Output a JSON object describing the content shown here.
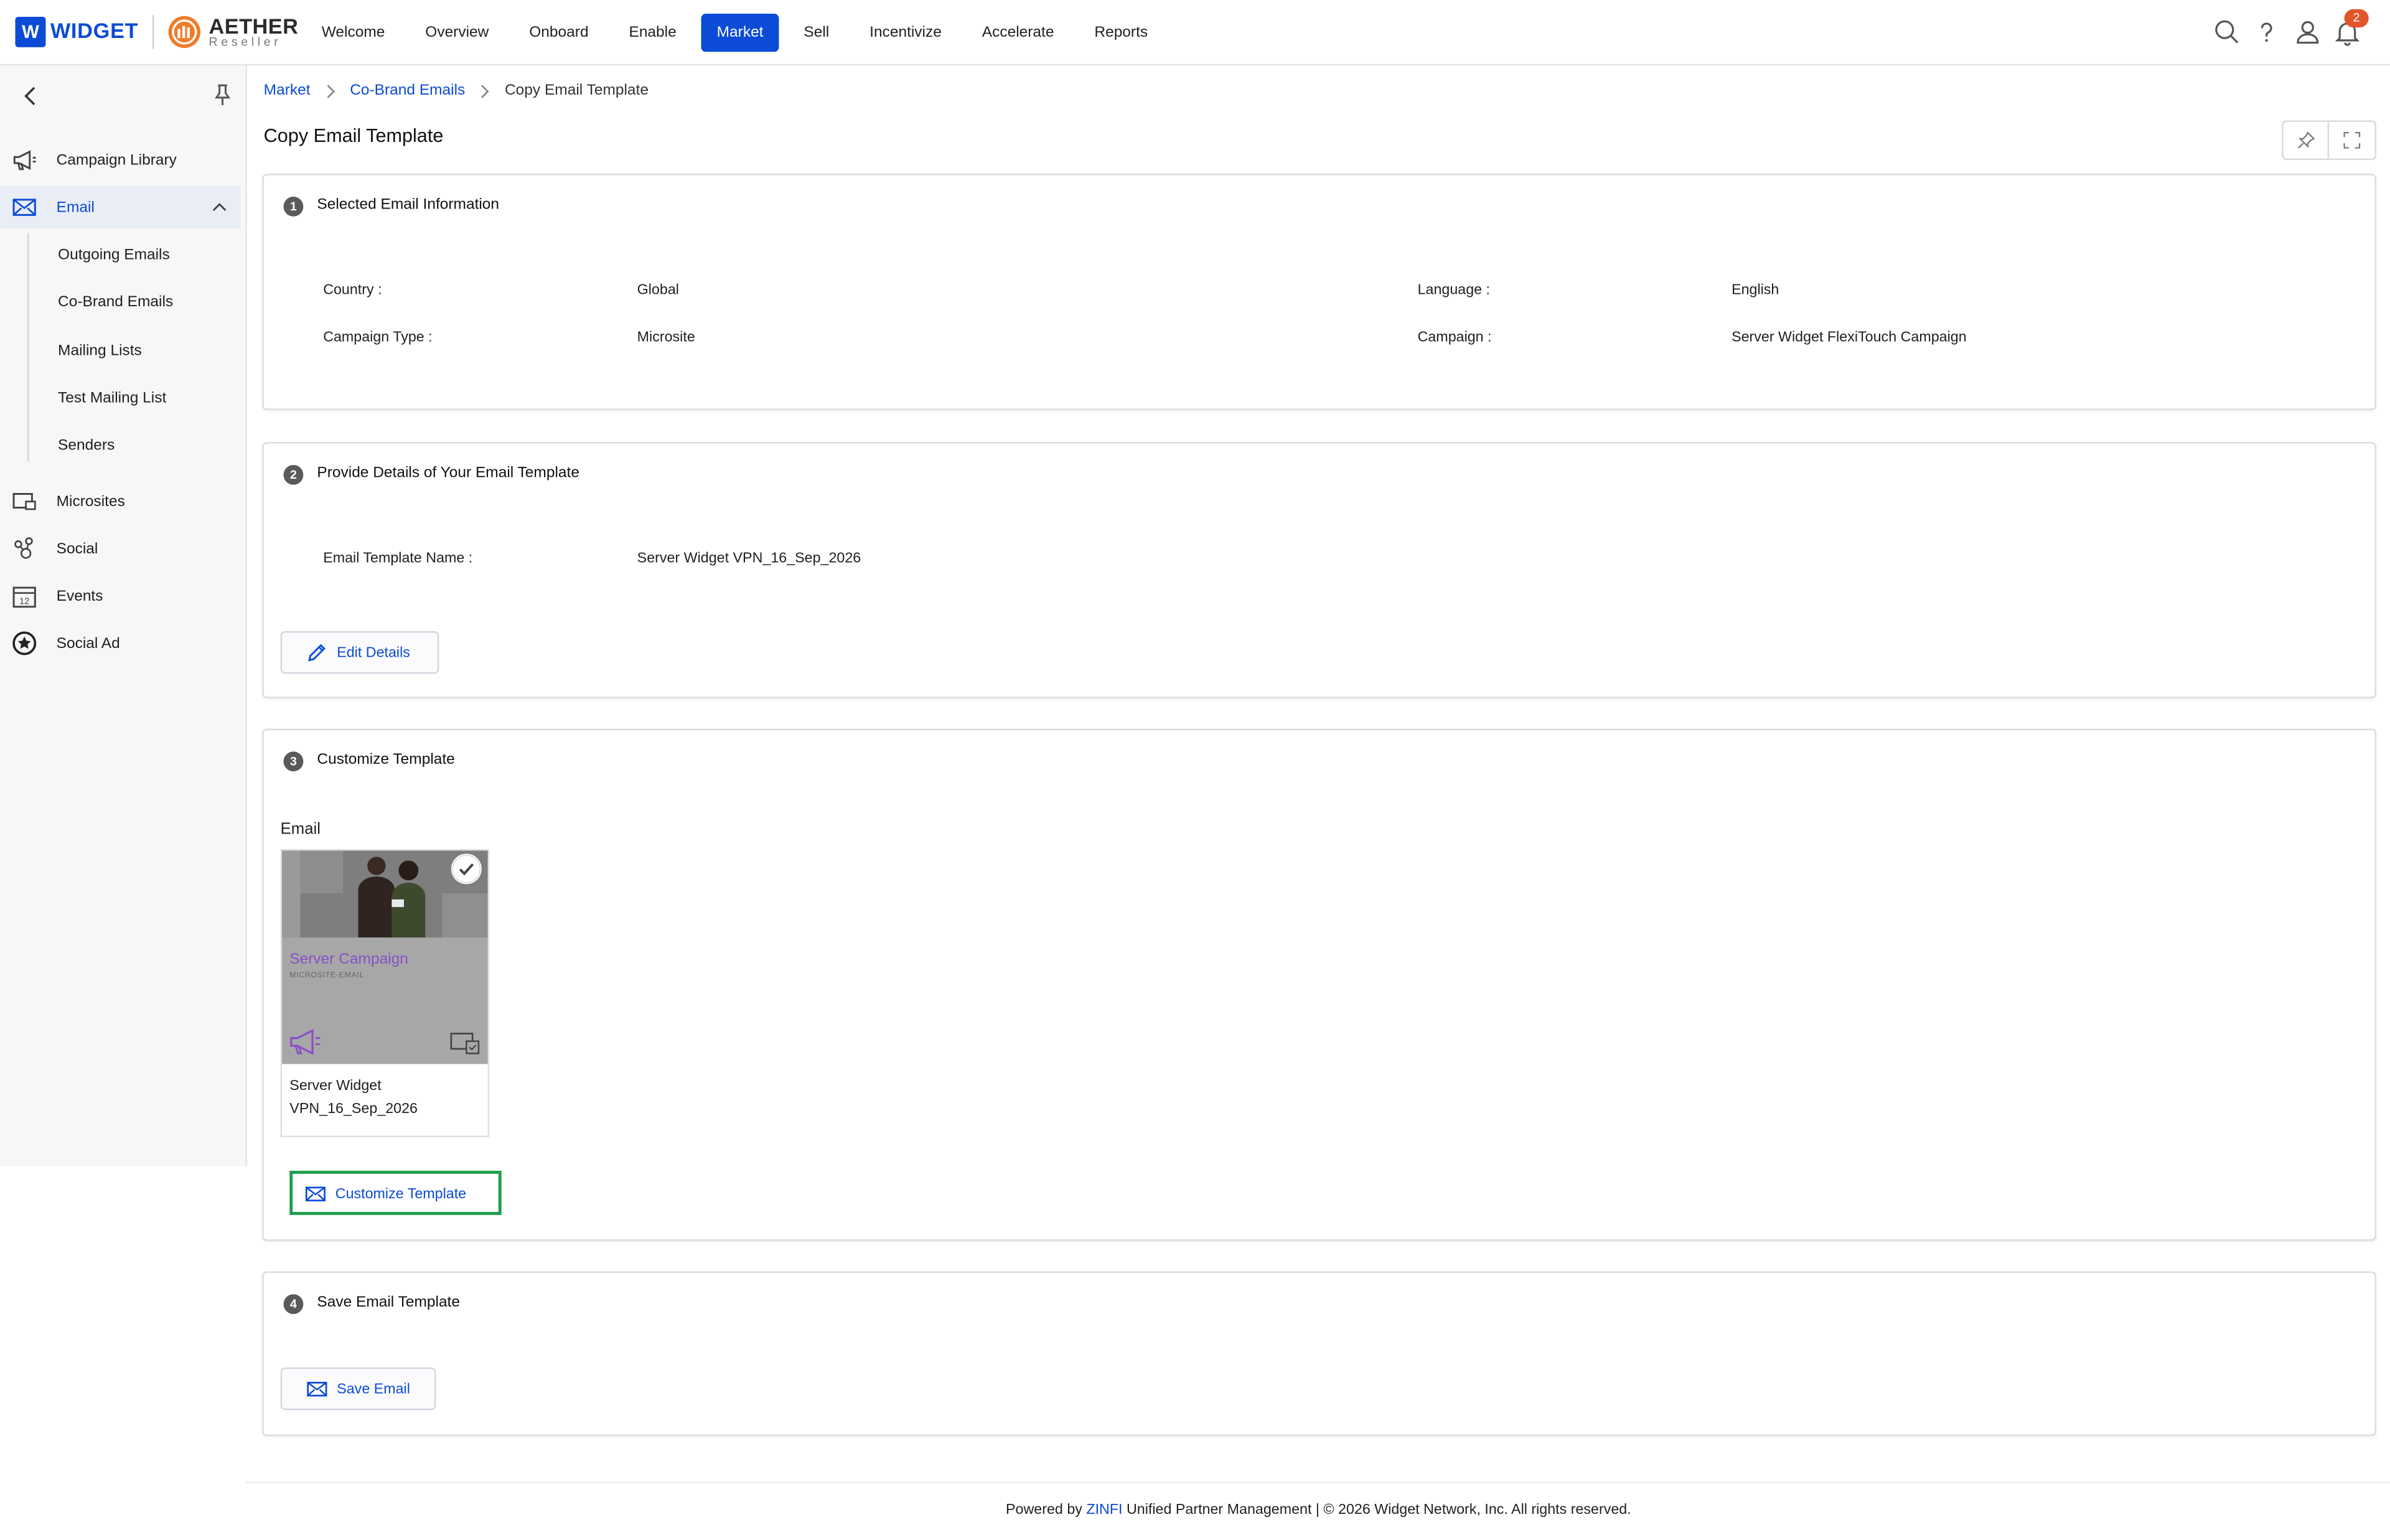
{
  "header": {
    "brand_w": "W",
    "brand_name": "WIDGET",
    "partner_name": "AETHER",
    "partner_sub": "Reseller",
    "nav": [
      "Welcome",
      "Overview",
      "Onboard",
      "Enable",
      "Market",
      "Sell",
      "Incentivize",
      "Accelerate",
      "Reports"
    ],
    "active_nav": "Market",
    "notification_count": "2",
    "icons": [
      "search-icon",
      "help-icon",
      "user-icon",
      "bell-icon"
    ]
  },
  "sidebar": {
    "items": [
      {
        "label": "Campaign Library",
        "icon": "megaphone-icon"
      },
      {
        "label": "Email",
        "icon": "envelope-icon"
      },
      {
        "label": "Microsites",
        "icon": "microsite-icon"
      },
      {
        "label": "Social",
        "icon": "social-icon"
      },
      {
        "label": "Events",
        "icon": "calendar-icon"
      },
      {
        "label": "Social Ad",
        "icon": "star-badge-icon"
      }
    ],
    "email_subitems": [
      "Outgoing Emails",
      "Co-Brand Emails",
      "Mailing Lists",
      "Test Mailing List",
      "Senders"
    ]
  },
  "breadcrumb": {
    "market": "Market",
    "cobrand": "Co-Brand Emails",
    "current": "Copy Email Template"
  },
  "page": {
    "title": "Copy Email Template"
  },
  "section1": {
    "step": "1",
    "title": "Selected Email Information",
    "country_label": "Country :",
    "country_value": "Global",
    "campaign_type_label": "Campaign Type :",
    "campaign_type_value": "Microsite",
    "language_label": "Language :",
    "language_value": "English",
    "campaign_label": "Campaign :",
    "campaign_value": "Server Widget FlexiTouch Campaign"
  },
  "section2": {
    "step": "2",
    "title": "Provide Details of Your Email Template",
    "name_label": "Email Template Name :",
    "name_value": "Server Widget VPN_16_Sep_2026",
    "edit_button": "Edit Details"
  },
  "section3": {
    "step": "3",
    "title": "Customize Template",
    "email_label": "Email",
    "template_card": {
      "campaign_title": "Server Campaign",
      "type_label": "MICROSITE-EMAIL",
      "name": "Server Widget VPN_16_Sep_2026",
      "selected": true
    },
    "customize_button": "Customize Template"
  },
  "section4": {
    "step": "4",
    "title": "Save Email Template",
    "save_button": "Save Email"
  },
  "footer": {
    "prefix": "Powered by",
    "link": "ZINFI",
    "suffix": "Unified Partner Management | © 2026 Widget Network, Inc. All rights reserved."
  }
}
